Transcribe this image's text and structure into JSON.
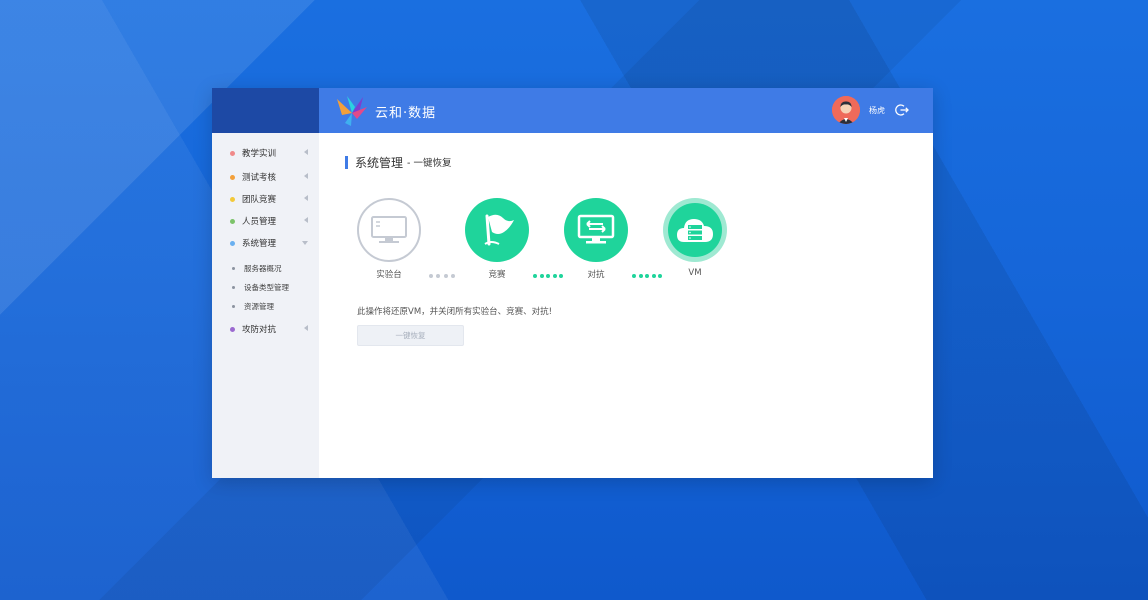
{
  "brand": {
    "name": "云和·数据"
  },
  "user": {
    "name": "杨虎"
  },
  "sidebar": {
    "items": [
      {
        "label": "教学实训",
        "color": "#f08a8a"
      },
      {
        "label": "测试考核",
        "color": "#f3a03a"
      },
      {
        "label": "团队竞赛",
        "color": "#f3c93a"
      },
      {
        "label": "人员管理",
        "color": "#7cc36a"
      },
      {
        "label": "系统管理",
        "color": "#6ab0f0"
      },
      {
        "label": "攻防对抗",
        "color": "#9b6ad0"
      }
    ],
    "sub_items": [
      "服务器概况",
      "设备类型管理",
      "资源管理"
    ]
  },
  "page": {
    "title": "系统管理",
    "subtitle": "- 一键恢复"
  },
  "steps": [
    {
      "label": "实验台",
      "state": "inactive",
      "icon": "monitor-icon"
    },
    {
      "label": "竞赛",
      "state": "active",
      "icon": "flag-icon"
    },
    {
      "label": "对抗",
      "state": "active",
      "icon": "exchange-monitor-icon"
    },
    {
      "label": "VM",
      "state": "active",
      "icon": "cloud-server-icon"
    }
  ],
  "warning_text": "此操作将还原VM，并关闭所有实验台、竞赛、对抗!",
  "restore_button": {
    "label": "一键恢复"
  },
  "colors": {
    "accent": "#3f7be6",
    "sidebar_brand": "#1d49a5",
    "step_active": "#1fd49b",
    "step_inactive": "#c5cad3"
  }
}
